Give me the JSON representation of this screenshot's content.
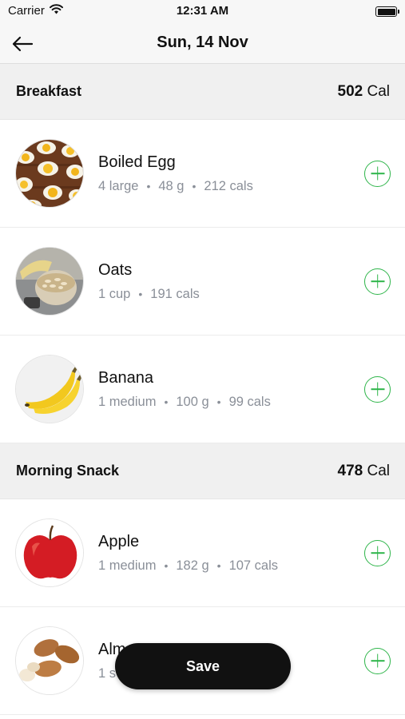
{
  "status_bar": {
    "carrier": "Carrier",
    "time": "12:31 AM"
  },
  "nav": {
    "title": "Sun, 14 Nov",
    "back_icon": "arrow-left-icon"
  },
  "sections": [
    {
      "title": "Breakfast",
      "calories": "502",
      "cal_unit": "Cal",
      "items": [
        {
          "name": "Boiled Egg",
          "meta": [
            "4 large",
            "48 g",
            "212 cals"
          ],
          "image": "boiled-egg"
        },
        {
          "name": "Oats",
          "meta": [
            "1 cup",
            "191 cals"
          ],
          "image": "oats"
        },
        {
          "name": "Banana",
          "meta": [
            "1 medium",
            "100 g",
            "99 cals"
          ],
          "image": "banana"
        }
      ]
    },
    {
      "title": "Morning Snack",
      "calories": "478",
      "cal_unit": "Cal",
      "items": [
        {
          "name": "Apple",
          "meta": [
            "1 medium",
            "182 g",
            "107 cals"
          ],
          "image": "apple"
        },
        {
          "name": "Alm",
          "meta": [
            "1 s"
          ],
          "image": "almonds"
        }
      ]
    }
  ],
  "save_label": "Save",
  "colors": {
    "accent_green": "#2eb54a",
    "save_bg": "#111111",
    "section_bg": "#f0f0f0",
    "meta_text": "#8a8f98"
  }
}
